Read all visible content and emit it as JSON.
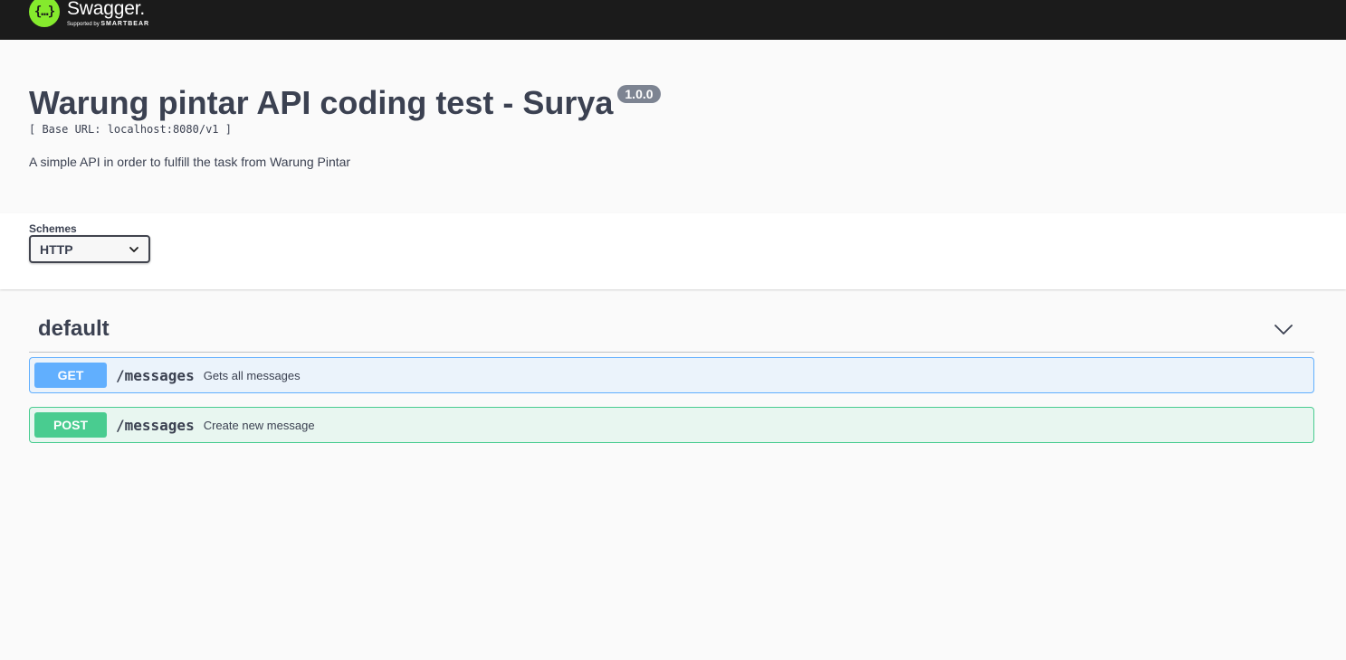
{
  "topbar": {
    "logo_mark": "{…}",
    "logo_name": "Swagger.",
    "logo_sub_prefix": "Supported by ",
    "logo_sub_brand": "SMARTBEAR"
  },
  "info": {
    "title": "Warung pintar API coding test - Surya",
    "version": "1.0.0",
    "base_url": "[ Base URL: localhost:8080/v1 ]",
    "description": "A simple API in order to fulfill the task from Warung Pintar"
  },
  "schemes": {
    "label": "Schemes",
    "selected": "HTTP",
    "icon": "chevron-down-icon"
  },
  "tag": {
    "name": "default",
    "toggle_icon": "chevron-down-icon"
  },
  "operations": [
    {
      "method": "GET",
      "path": "/messages",
      "summary": "Gets all messages",
      "color": "#61affe"
    },
    {
      "method": "POST",
      "path": "/messages",
      "summary": "Create new message",
      "color": "#49cc90"
    }
  ],
  "colors": {
    "topbar": "#1b1b1b",
    "logo_green": "#85ea2d",
    "get": "#61affe",
    "post": "#49cc90",
    "text": "#3b4151"
  }
}
